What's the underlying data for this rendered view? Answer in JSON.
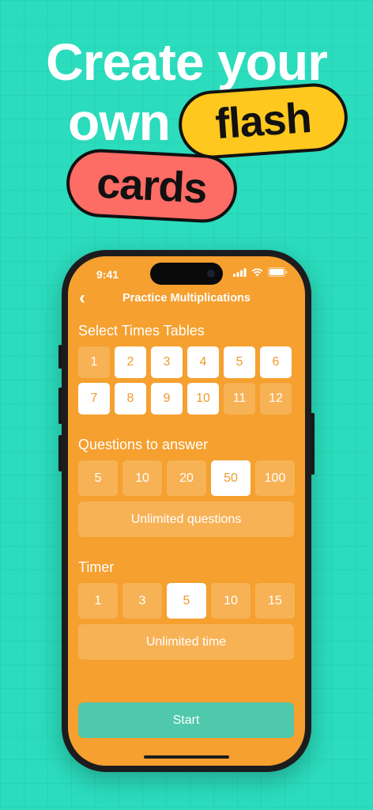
{
  "headline": {
    "line1": "Create your",
    "line2": "own",
    "pill_flash": "flash",
    "pill_cards": "cards",
    "pill_flash_color": "#fec81e",
    "pill_cards_color": "#fe6c66"
  },
  "status_bar": {
    "time": "9:41"
  },
  "nav": {
    "back_icon": "chevron-left-icon",
    "title": "Practice Multiplications"
  },
  "times_tables": {
    "title": "Select Times Tables",
    "options": [
      {
        "label": "1",
        "selected": false
      },
      {
        "label": "2",
        "selected": true
      },
      {
        "label": "3",
        "selected": true
      },
      {
        "label": "4",
        "selected": true
      },
      {
        "label": "5",
        "selected": true
      },
      {
        "label": "6",
        "selected": true
      },
      {
        "label": "7",
        "selected": true
      },
      {
        "label": "8",
        "selected": true
      },
      {
        "label": "9",
        "selected": true
      },
      {
        "label": "10",
        "selected": true
      },
      {
        "label": "11",
        "selected": false
      },
      {
        "label": "12",
        "selected": false
      }
    ]
  },
  "questions": {
    "title": "Questions to answer",
    "options": [
      {
        "label": "5",
        "selected": false
      },
      {
        "label": "10",
        "selected": false
      },
      {
        "label": "20",
        "selected": false
      },
      {
        "label": "50",
        "selected": true
      },
      {
        "label": "100",
        "selected": false
      }
    ],
    "unlimited_label": "Unlimited questions"
  },
  "timer": {
    "title": "Timer",
    "options": [
      {
        "label": "1",
        "selected": false
      },
      {
        "label": "3",
        "selected": false
      },
      {
        "label": "5",
        "selected": true
      },
      {
        "label": "10",
        "selected": false
      },
      {
        "label": "15",
        "selected": false
      }
    ],
    "unlimited_label": "Unlimited time"
  },
  "start_label": "Start",
  "colors": {
    "background": "#2bdcbd",
    "screen": "#f5a02f",
    "option_unselected": "#f7b256",
    "option_selected": "#ffffff",
    "selected_text": "#f19a2b",
    "start_button": "#4fc8ac"
  }
}
